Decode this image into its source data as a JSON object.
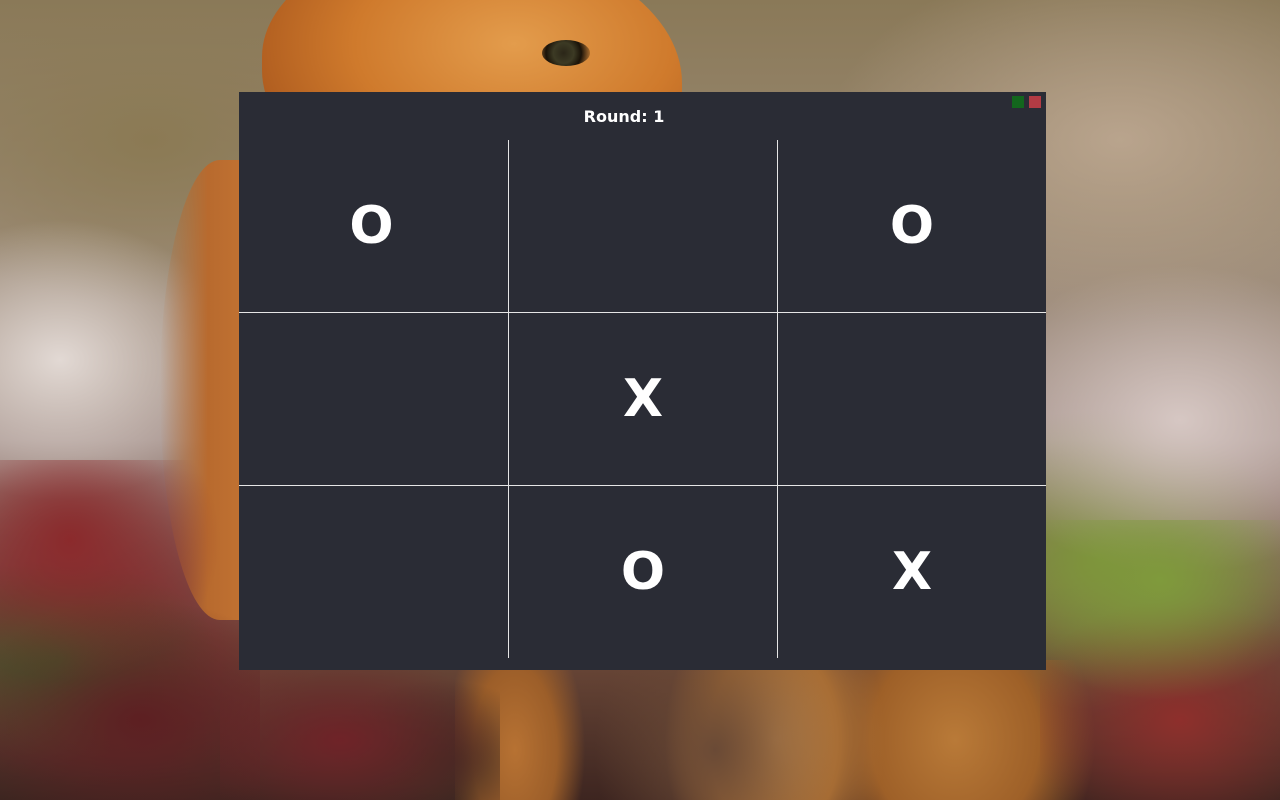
{
  "window": {
    "round_label": "Round: 1",
    "colors": {
      "background": "#2a2c35",
      "text": "#ffffff",
      "grid_lines": "#e6e6e6",
      "maximize_button": "#13661d",
      "close_button": "#b23b44"
    }
  },
  "board": {
    "cells": [
      [
        "O",
        "",
        "O"
      ],
      [
        "",
        "X",
        ""
      ],
      [
        "",
        "O",
        "X"
      ]
    ]
  }
}
